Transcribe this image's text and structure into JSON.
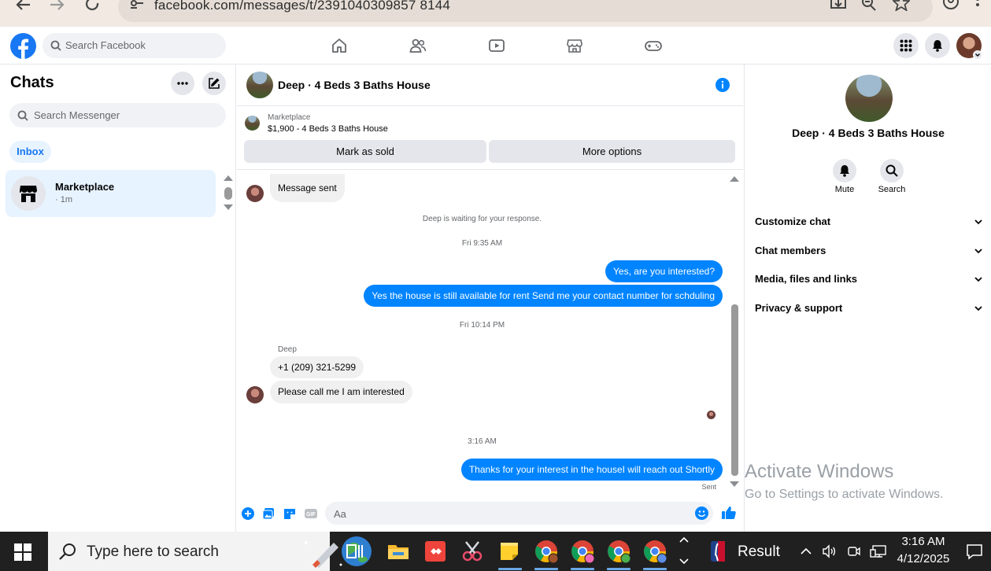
{
  "browser": {
    "url": "facebook.com/messages/t/2391040309857 8144"
  },
  "fb_header": {
    "search_placeholder": "Search Facebook"
  },
  "sidebar": {
    "title": "Chats",
    "search_placeholder": "Search Messenger",
    "filter": "Inbox",
    "chats": [
      {
        "name": "Marketplace",
        "time": "· 1m"
      }
    ]
  },
  "conversation": {
    "title": "Deep · 4 Beds 3 Baths House",
    "marketplace_label": "Marketplace",
    "listing": "$1,900 - 4 Beds 3 Baths House",
    "mark_sold_label": "Mark as sold",
    "more_options_label": "More options",
    "messages": {
      "m1": "Message sent",
      "waiting": "Deep is waiting for your response.",
      "time1": "Fri 9:35 AM",
      "out1": "Yes, are you interested?",
      "out2": "Yes the house is still available for rent Send me your contact number for schduling",
      "time2": "Fri 10:14 PM",
      "sender": "Deep",
      "in1": "+1 (209) 321-5299",
      "in2": "Please call me I am interested",
      "time3": "3:16 AM",
      "out3": "Thanks for your interest in the houseI will reach out Shortly",
      "status": "Sent"
    },
    "composer_placeholder": "Aa"
  },
  "right_panel": {
    "title": "Deep · 4 Beds 3 Baths House",
    "actions": {
      "mute": "Mute",
      "search": "Search"
    },
    "sections": {
      "customize": "Customize chat",
      "members": "Chat members",
      "media": "Media, files and links",
      "privacy": "Privacy & support"
    }
  },
  "watermark": {
    "title": "Activate Windows",
    "subtitle": "Go to Settings to activate Windows."
  },
  "taskbar": {
    "search_placeholder": "Type here to search",
    "weather_label": "Result",
    "time": "3:16 AM",
    "date": "4/12/2025"
  },
  "colors": {
    "fb_blue": "#1877f2",
    "messenger_blue": "#0084ff",
    "taskbar": "#202020"
  }
}
